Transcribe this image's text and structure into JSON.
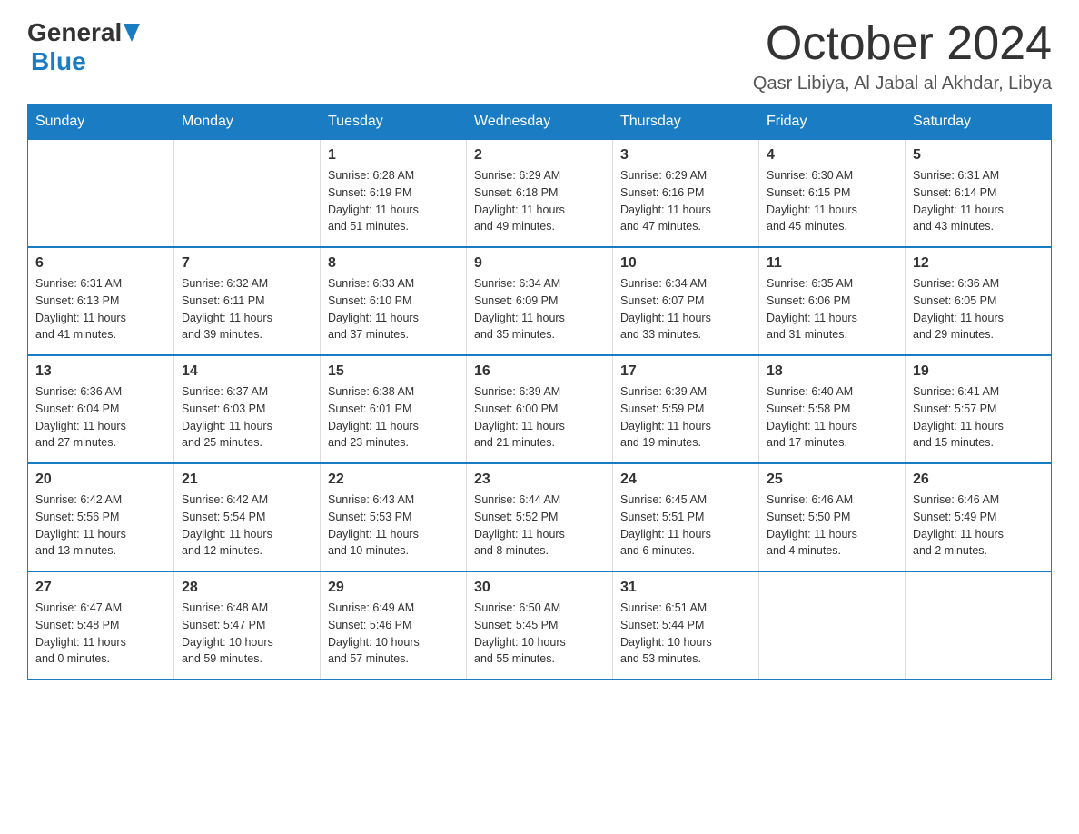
{
  "header": {
    "logo_general": "General",
    "logo_blue": "Blue",
    "title": "October 2024",
    "subtitle": "Qasr Libiya, Al Jabal al Akhdar, Libya"
  },
  "calendar": {
    "days_of_week": [
      "Sunday",
      "Monday",
      "Tuesday",
      "Wednesday",
      "Thursday",
      "Friday",
      "Saturday"
    ],
    "weeks": [
      [
        {
          "day": "",
          "info": ""
        },
        {
          "day": "",
          "info": ""
        },
        {
          "day": "1",
          "info": "Sunrise: 6:28 AM\nSunset: 6:19 PM\nDaylight: 11 hours\nand 51 minutes."
        },
        {
          "day": "2",
          "info": "Sunrise: 6:29 AM\nSunset: 6:18 PM\nDaylight: 11 hours\nand 49 minutes."
        },
        {
          "day": "3",
          "info": "Sunrise: 6:29 AM\nSunset: 6:16 PM\nDaylight: 11 hours\nand 47 minutes."
        },
        {
          "day": "4",
          "info": "Sunrise: 6:30 AM\nSunset: 6:15 PM\nDaylight: 11 hours\nand 45 minutes."
        },
        {
          "day": "5",
          "info": "Sunrise: 6:31 AM\nSunset: 6:14 PM\nDaylight: 11 hours\nand 43 minutes."
        }
      ],
      [
        {
          "day": "6",
          "info": "Sunrise: 6:31 AM\nSunset: 6:13 PM\nDaylight: 11 hours\nand 41 minutes."
        },
        {
          "day": "7",
          "info": "Sunrise: 6:32 AM\nSunset: 6:11 PM\nDaylight: 11 hours\nand 39 minutes."
        },
        {
          "day": "8",
          "info": "Sunrise: 6:33 AM\nSunset: 6:10 PM\nDaylight: 11 hours\nand 37 minutes."
        },
        {
          "day": "9",
          "info": "Sunrise: 6:34 AM\nSunset: 6:09 PM\nDaylight: 11 hours\nand 35 minutes."
        },
        {
          "day": "10",
          "info": "Sunrise: 6:34 AM\nSunset: 6:07 PM\nDaylight: 11 hours\nand 33 minutes."
        },
        {
          "day": "11",
          "info": "Sunrise: 6:35 AM\nSunset: 6:06 PM\nDaylight: 11 hours\nand 31 minutes."
        },
        {
          "day": "12",
          "info": "Sunrise: 6:36 AM\nSunset: 6:05 PM\nDaylight: 11 hours\nand 29 minutes."
        }
      ],
      [
        {
          "day": "13",
          "info": "Sunrise: 6:36 AM\nSunset: 6:04 PM\nDaylight: 11 hours\nand 27 minutes."
        },
        {
          "day": "14",
          "info": "Sunrise: 6:37 AM\nSunset: 6:03 PM\nDaylight: 11 hours\nand 25 minutes."
        },
        {
          "day": "15",
          "info": "Sunrise: 6:38 AM\nSunset: 6:01 PM\nDaylight: 11 hours\nand 23 minutes."
        },
        {
          "day": "16",
          "info": "Sunrise: 6:39 AM\nSunset: 6:00 PM\nDaylight: 11 hours\nand 21 minutes."
        },
        {
          "day": "17",
          "info": "Sunrise: 6:39 AM\nSunset: 5:59 PM\nDaylight: 11 hours\nand 19 minutes."
        },
        {
          "day": "18",
          "info": "Sunrise: 6:40 AM\nSunset: 5:58 PM\nDaylight: 11 hours\nand 17 minutes."
        },
        {
          "day": "19",
          "info": "Sunrise: 6:41 AM\nSunset: 5:57 PM\nDaylight: 11 hours\nand 15 minutes."
        }
      ],
      [
        {
          "day": "20",
          "info": "Sunrise: 6:42 AM\nSunset: 5:56 PM\nDaylight: 11 hours\nand 13 minutes."
        },
        {
          "day": "21",
          "info": "Sunrise: 6:42 AM\nSunset: 5:54 PM\nDaylight: 11 hours\nand 12 minutes."
        },
        {
          "day": "22",
          "info": "Sunrise: 6:43 AM\nSunset: 5:53 PM\nDaylight: 11 hours\nand 10 minutes."
        },
        {
          "day": "23",
          "info": "Sunrise: 6:44 AM\nSunset: 5:52 PM\nDaylight: 11 hours\nand 8 minutes."
        },
        {
          "day": "24",
          "info": "Sunrise: 6:45 AM\nSunset: 5:51 PM\nDaylight: 11 hours\nand 6 minutes."
        },
        {
          "day": "25",
          "info": "Sunrise: 6:46 AM\nSunset: 5:50 PM\nDaylight: 11 hours\nand 4 minutes."
        },
        {
          "day": "26",
          "info": "Sunrise: 6:46 AM\nSunset: 5:49 PM\nDaylight: 11 hours\nand 2 minutes."
        }
      ],
      [
        {
          "day": "27",
          "info": "Sunrise: 6:47 AM\nSunset: 5:48 PM\nDaylight: 11 hours\nand 0 minutes."
        },
        {
          "day": "28",
          "info": "Sunrise: 6:48 AM\nSunset: 5:47 PM\nDaylight: 10 hours\nand 59 minutes."
        },
        {
          "day": "29",
          "info": "Sunrise: 6:49 AM\nSunset: 5:46 PM\nDaylight: 10 hours\nand 57 minutes."
        },
        {
          "day": "30",
          "info": "Sunrise: 6:50 AM\nSunset: 5:45 PM\nDaylight: 10 hours\nand 55 minutes."
        },
        {
          "day": "31",
          "info": "Sunrise: 6:51 AM\nSunset: 5:44 PM\nDaylight: 10 hours\nand 53 minutes."
        },
        {
          "day": "",
          "info": ""
        },
        {
          "day": "",
          "info": ""
        }
      ]
    ]
  }
}
